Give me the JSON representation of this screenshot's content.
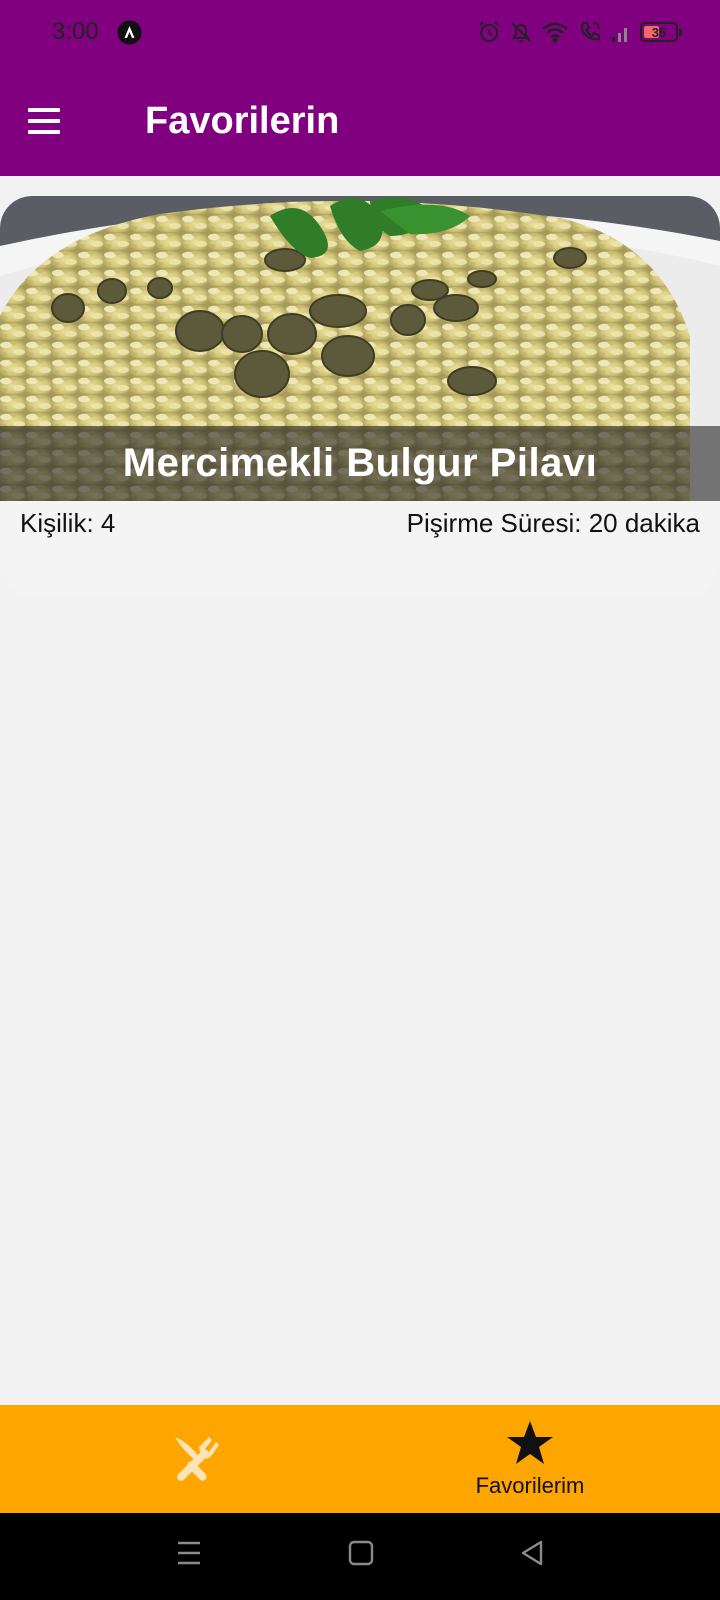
{
  "status_bar": {
    "time": "3:00",
    "battery_level": "35",
    "icons": [
      "app-notification-icon",
      "alarm-icon",
      "mute-bell-icon",
      "wifi-icon",
      "wifi-call-icon",
      "signal-icon",
      "battery-icon"
    ]
  },
  "app_bar": {
    "title": "Favorilerin",
    "menu_icon": "menu-icon"
  },
  "recipe": {
    "title": "Mercimekli Bulgur Pilavı",
    "servings": "Kişilik: 4",
    "cook_time": "Pişirme Süresi: 20 dakika"
  },
  "tab_bar": {
    "tabs": [
      {
        "icon": "fork-knife-icon",
        "label": ""
      },
      {
        "icon": "star-icon",
        "label": "Favorilerim"
      }
    ]
  },
  "system_nav": {
    "buttons": [
      "recent-apps-icon",
      "home-icon",
      "back-icon"
    ]
  },
  "colors": {
    "primary": "#800080",
    "tab_bar": "#ffa500",
    "tab_inactive_icon": "#fde3b5",
    "background": "#f2f2f2"
  }
}
